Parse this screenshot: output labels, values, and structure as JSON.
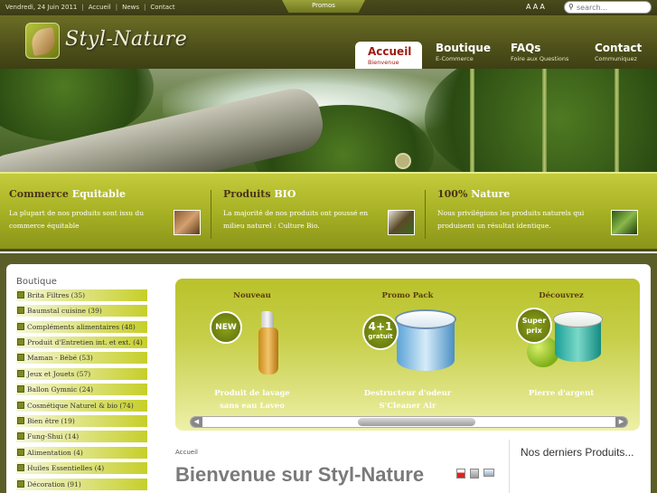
{
  "topbar": {
    "date": "Vendredi, 24 Juin 2011",
    "links": [
      "Accueil",
      "News",
      "Contact"
    ],
    "promos": "Promos",
    "font_sizes": [
      "A",
      "A",
      "A"
    ],
    "search_placeholder": "search..."
  },
  "header": {
    "logo_text": "Styl-Nature",
    "nav": [
      {
        "title": "Accueil",
        "sub": "Bienvenue"
      },
      {
        "title": "Boutique",
        "sub": "E-Commerce"
      },
      {
        "title": "FAQs",
        "sub": "Foire aux Questions"
      },
      {
        "title": "Contact",
        "sub": "Communiquez"
      }
    ]
  },
  "features": [
    {
      "title_a": "Commerce ",
      "title_b": "Equitable",
      "desc": "La plupart de nos produits sont issu du commerce équitable"
    },
    {
      "title_a": "Produits ",
      "title_b": "BIO",
      "desc": "La majorité de nos produits ont poussé en milieu naturel : Culture Bio."
    },
    {
      "title_a": "100% ",
      "title_b": "Nature",
      "desc": "Nous privilégions les produits naturels qui produisent un résultat identique."
    }
  ],
  "sidebar": {
    "title": "Boutique",
    "categories": [
      "Brita Filtres (35)",
      "Baumstal cuisine (39)",
      "Compléments alimentaires (48)",
      "Produit d'Entretien int. et ext. (4)",
      "Maman - Bébé (53)",
      "Jeux et Jouets (57)",
      "Ballon Gymnic (24)",
      "Cosmétique Naturel & bio (74)",
      "Bien être (19)",
      "Fung-Shui (14)",
      "Alimentation (4)",
      "Huiles Essentielles (4)",
      "Décoration (91)"
    ]
  },
  "promo": {
    "columns": [
      {
        "heading": "Nouveau",
        "badge": "NEW",
        "name_1": "Produit de lavage",
        "name_2": "sans eau Laveo"
      },
      {
        "heading": "Promo Pack",
        "badge_1": "4+1",
        "badge_2": "gratuit",
        "name_1": "Destructeur d'odeur",
        "name_2": "S'Cleaner Air"
      },
      {
        "heading": "Découvrez",
        "badge_1": "Super",
        "badge_2": "prix",
        "name_1": "Pierre d'argent",
        "name_2": ""
      }
    ]
  },
  "content": {
    "breadcrumb": "Accueil",
    "title": "Bienvenue sur Styl-Nature",
    "latest_title_a": "Nos ",
    "latest_title_b": "derniers Produits..."
  },
  "colors": {
    "header_dark": "#4e501a",
    "accent_green": "#b9c22a",
    "active_tab_text": "#a01a10"
  }
}
